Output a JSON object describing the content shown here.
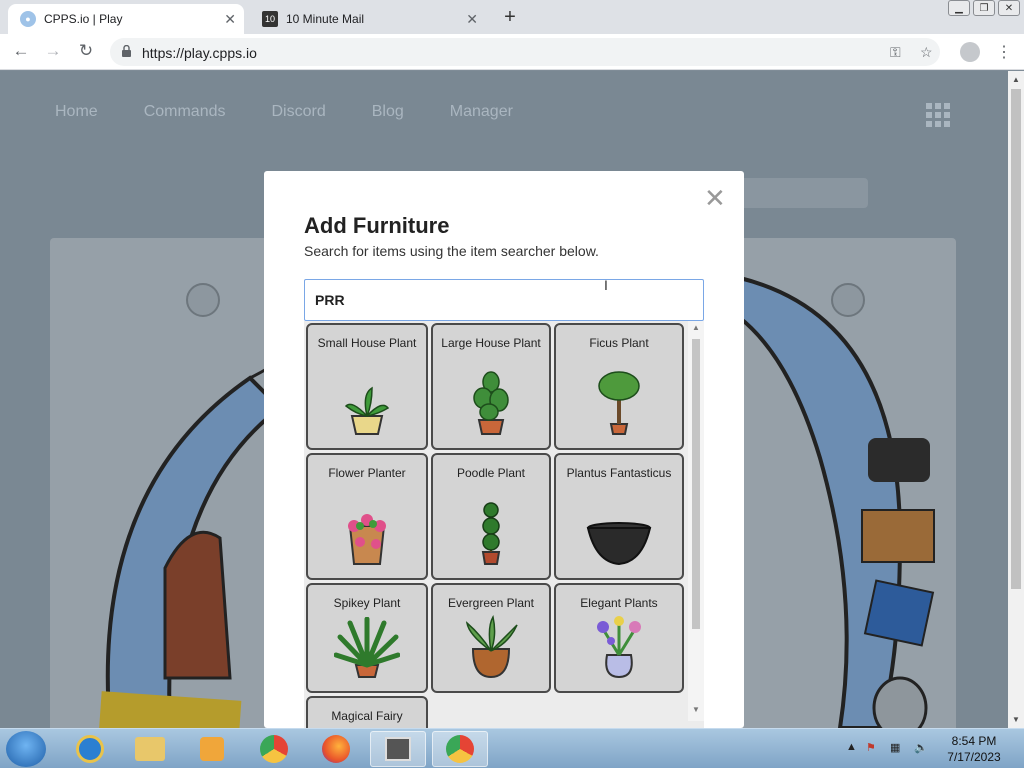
{
  "browser": {
    "tabs": [
      {
        "title": "CPPS.io | Play",
        "active": true
      },
      {
        "title": "10 Minute Mail",
        "active": false
      }
    ],
    "url": "https://play.cpps.io"
  },
  "site_nav": [
    "Home",
    "Commands",
    "Discord",
    "Blog",
    "Manager"
  ],
  "modal": {
    "title": "Add Furniture",
    "subtitle": "Search for items using the item searcher below.",
    "search_value": "PRR",
    "items": [
      {
        "name": "Small House Plant",
        "icon": "small-house-plant-icon"
      },
      {
        "name": "Large House Plant",
        "icon": "large-house-plant-icon"
      },
      {
        "name": "Ficus Plant",
        "icon": "ficus-plant-icon"
      },
      {
        "name": "Flower Planter",
        "icon": "flower-planter-icon"
      },
      {
        "name": "Poodle Plant",
        "icon": "poodle-plant-icon"
      },
      {
        "name": "Plantus Fantasticus",
        "icon": "plantus-fantasticus-icon"
      },
      {
        "name": "Spikey Plant",
        "icon": "spikey-plant-icon"
      },
      {
        "name": "Evergreen Plant",
        "icon": "evergreen-plant-icon"
      },
      {
        "name": "Elegant Plants",
        "icon": "elegant-plants-icon"
      },
      {
        "name": "Magical Fairy",
        "icon": "magical-fairy-icon"
      }
    ]
  },
  "taskbar": {
    "time": "8:54 PM",
    "date": "7/17/2023"
  }
}
